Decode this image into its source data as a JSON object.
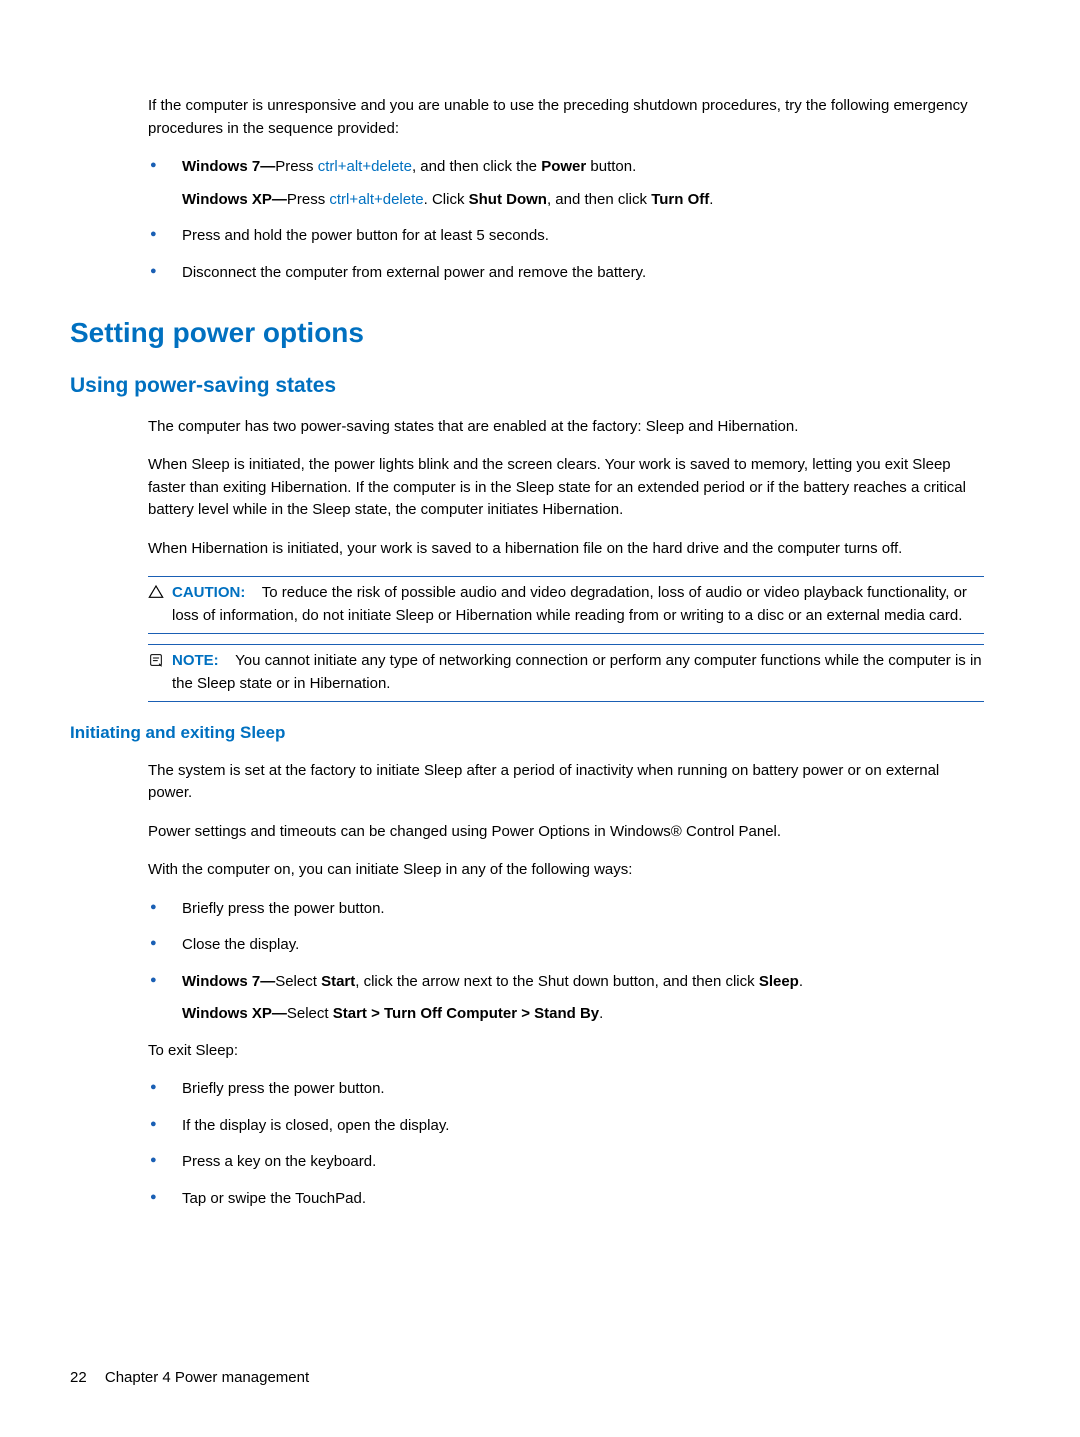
{
  "intro": {
    "p1": "If the computer is unresponsive and you are unable to use the preceding shutdown procedures, try the following emergency procedures in the sequence provided:",
    "bullets": {
      "b1_win7_pre": "Windows 7—",
      "b1_win7_mid": "Press ",
      "b1_keycombo": "ctrl+alt+delete",
      "b1_win7_post1": ", and then click the ",
      "b1_power": "Power",
      "b1_win7_post2": " button.",
      "b1_xp_pre": "Windows XP—",
      "b1_xp_mid": "Press ",
      "b1_xp_post1": ". Click ",
      "b1_shutdown": "Shut Down",
      "b1_xp_post2": ", and then click ",
      "b1_turnoff": "Turn Off",
      "b1_xp_post3": ".",
      "b2": "Press and hold the power button for at least 5 seconds.",
      "b3": "Disconnect the computer from external power and remove the battery."
    }
  },
  "h1": "Setting power options",
  "h2": "Using power-saving states",
  "section1": {
    "p1": "The computer has two power-saving states that are enabled at the factory: Sleep and Hibernation.",
    "p2": "When Sleep is initiated, the power lights blink and the screen clears. Your work is saved to memory, letting you exit Sleep faster than exiting Hibernation. If the computer is in the Sleep state for an extended period or if the battery reaches a critical battery level while in the Sleep state, the computer initiates Hibernation.",
    "p3": "When Hibernation is initiated, your work is saved to a hibernation file on the hard drive and the computer turns off."
  },
  "caution": {
    "label": "CAUTION:",
    "body": "To reduce the risk of possible audio and video degradation, loss of audio or video playback functionality, or loss of information, do not initiate Sleep or Hibernation while reading from or writing to a disc or an external media card."
  },
  "note": {
    "label": "NOTE:",
    "body": "You cannot initiate any type of networking connection or perform any computer functions while the computer is in the Sleep state or in Hibernation."
  },
  "h3": "Initiating and exiting Sleep",
  "section2": {
    "p1": "The system is set at the factory to initiate Sleep after a period of inactivity when running on battery power or on external power.",
    "p2": "Power settings and timeouts can be changed using Power Options in Windows® Control Panel.",
    "p3": "With the computer on, you can initiate Sleep in any of the following ways:",
    "list1": {
      "b1": "Briefly press the power button.",
      "b2": "Close the display.",
      "b3_win7_pre": "Windows 7—",
      "b3_win7_mid1": "Select ",
      "b3_start": "Start",
      "b3_win7_mid2": ", click the arrow next to the Shut down button, and then click ",
      "b3_sleep": "Sleep",
      "b3_win7_end": ".",
      "b3_xp_pre": "Windows XP—",
      "b3_xp_mid": "Select ",
      "b3_xp_path": "Start > Turn Off Computer > Stand By",
      "b3_xp_end": "."
    },
    "p4": "To exit Sleep:",
    "list2": {
      "b1": "Briefly press the power button.",
      "b2": "If the display is closed, open the display.",
      "b3": "Press a key on the keyboard.",
      "b4": "Tap or swipe the TouchPad."
    }
  },
  "footer": {
    "page": "22",
    "chapter": "Chapter 4   Power management"
  }
}
